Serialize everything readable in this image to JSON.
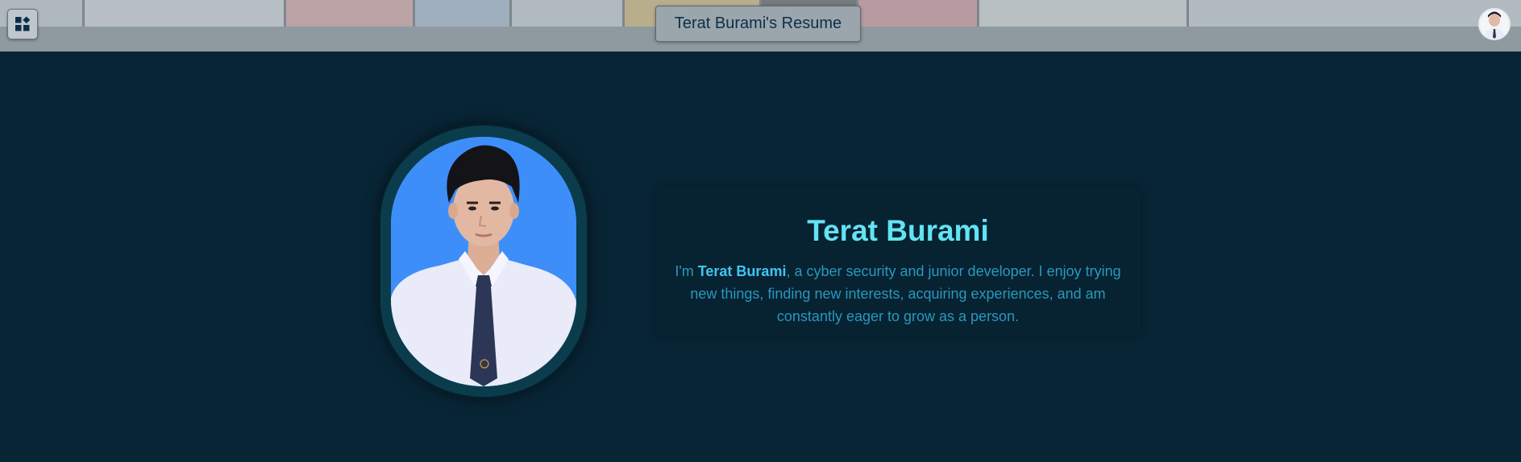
{
  "header": {
    "menu_icon": "apps-grid-icon",
    "title": "Terat Burami's Resume",
    "avatar_icon": "profile-avatar-icon"
  },
  "profile": {
    "name": "Terat Burami",
    "bio_prefix": "I'm ",
    "bio_name": "Terat Burami",
    "bio_suffix": ", a cyber security and junior developer. I enjoy trying new things, finding new interests, acquiring experiences, and am constantly eager to grow as a person."
  },
  "colors": {
    "background": "#082536",
    "topbar": "#8e9aa0",
    "accent_name": "#63e3f4",
    "body_text": "#2a98bd",
    "highlight": "#3ec6f0",
    "title_text": "#0d2e4a"
  }
}
